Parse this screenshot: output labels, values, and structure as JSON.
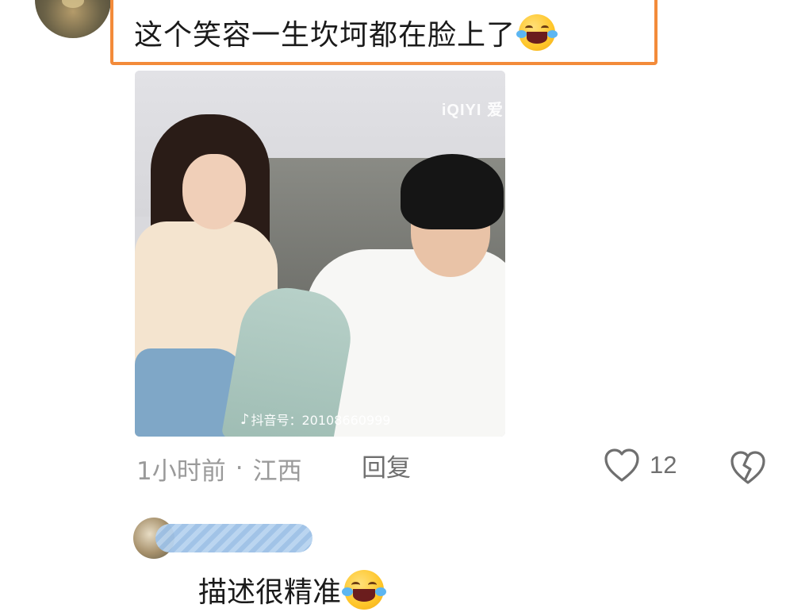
{
  "comment": {
    "text": "这个笑容一生坎坷都在脸上了",
    "emoji": "laughing-crying-emoji",
    "highlight_color": "#f38b3a"
  },
  "photo": {
    "watermark_top": "iQIYI 爱",
    "watermark_bottom": "抖音号：20108660999"
  },
  "meta": {
    "time": "1小时前",
    "separator": "·",
    "location": "江西",
    "reply_label": "回复",
    "like_count": "12"
  },
  "reply": {
    "text": "描述很精准",
    "emoji": "laughing-crying-emoji"
  },
  "colors": {
    "text_primary": "#1a1a1a",
    "text_secondary": "#9a9a9a",
    "action_icon": "#6f6f6f",
    "blur_username": "#9cc0e6"
  }
}
